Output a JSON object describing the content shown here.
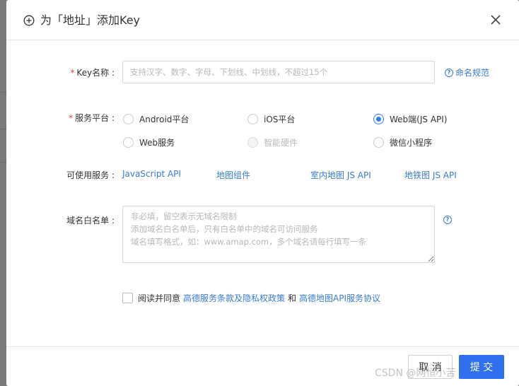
{
  "header": {
    "title": "为「地址」添加Key"
  },
  "form": {
    "key_name": {
      "required_mark": "*",
      "label": "Key名称 :",
      "placeholder": "支持汉字、数字、字母、下划线、中划线，不超过15个",
      "help_link": "命名规范"
    },
    "platform": {
      "required_mark": "*",
      "label": "服务平台 :",
      "options": [
        {
          "label": "Android平台",
          "checked": false,
          "disabled": false
        },
        {
          "label": "iOS平台",
          "checked": false,
          "disabled": false
        },
        {
          "label": "Web端(JS API)",
          "checked": true,
          "disabled": false
        },
        {
          "label": "Web服务",
          "checked": false,
          "disabled": false
        },
        {
          "label": "智能硬件",
          "checked": false,
          "disabled": true
        },
        {
          "label": "微信小程序",
          "checked": false,
          "disabled": false
        }
      ]
    },
    "services": {
      "label": "可使用服务 :",
      "links": [
        "JavaScript API",
        "地图组件",
        "室内地图 JS API",
        "地铁图 JS API"
      ]
    },
    "whitelist": {
      "label": "域名白名单 :",
      "placeholder": "非必填，留空表示无域名限制\n添加域名白名单后，只有白名单中的域名可访问服务\n域名填写格式，如：www.amap.com，多个域名请每行填写一条"
    },
    "agreement": {
      "prefix": "阅读并同意",
      "link1": "高德服务条款及隐私权政策",
      "connector": "和",
      "link2": "高德地图API服务协议"
    }
  },
  "footer": {
    "cancel_label": "取 消",
    "submit_label": "提 交"
  },
  "watermark": "CSDN @网恒小苦",
  "colors": {
    "accent": "#2f6ff0",
    "link": "#3a7bd5",
    "required": "#e4393c"
  },
  "icons": {
    "title": "plus-circle-icon",
    "close": "close-icon",
    "help": "question-circle-icon"
  }
}
